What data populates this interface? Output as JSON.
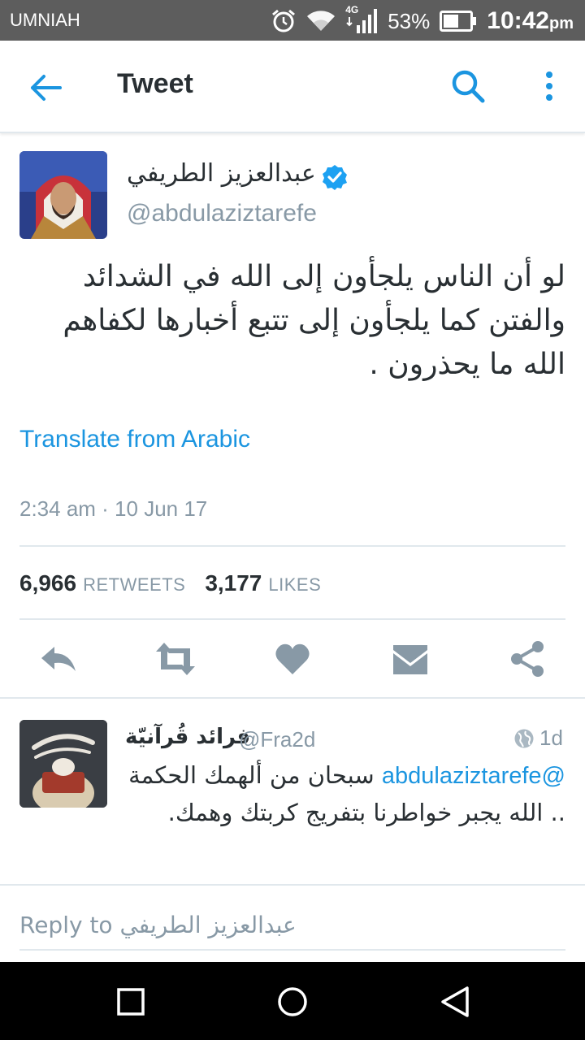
{
  "status_bar": {
    "carrier": "UMNIAH",
    "network": "4G",
    "battery": "53%",
    "time": "10:42",
    "time_suffix": "pm"
  },
  "app_bar": {
    "title": "Tweet",
    "icons": [
      "back-arrow-icon",
      "search-icon",
      "more-vertical-icon"
    ]
  },
  "tweet": {
    "author_name": "عبدالعزيز الطريفي",
    "author_handle": "@abdulaziztarefe",
    "verified": true,
    "text": "لو أن الناس يلجأون إلى الله في الشدائد والفتن كما يلجأون إلى تتبع أخبارها لكفاهم الله ما يحذرون .",
    "translate_label": "Translate from Arabic",
    "timestamp": "2:34 am · 10 Jun 17",
    "retweets_count": "6,966",
    "retweets_label": "RETWEETS",
    "likes_count": "3,177",
    "likes_label": "LIKES",
    "actions": [
      "reply-icon",
      "retweet-icon",
      "like-icon",
      "direct-message-icon",
      "share-icon"
    ]
  },
  "reply": {
    "name": "فرائد قُرآنيّة",
    "handle": "@Fra2d",
    "time": "1d",
    "mention": "@abdulaziztarefe",
    "text": "سبحان من ألهمك الحكمة .. الله يجبر خواطرنا بتفريج كربتك وهمك."
  },
  "reply_bar": {
    "placeholder": "Reply to عبدالعزيز الطريفي"
  },
  "colors": {
    "accent": "#1b95e0",
    "icon_gray": "#8899a6",
    "status_bar": "#5d5d5d",
    "text": "#292f33"
  }
}
